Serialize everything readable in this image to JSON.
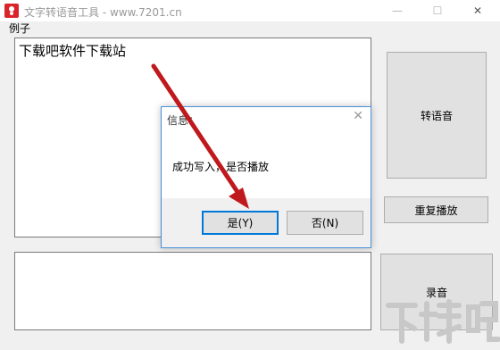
{
  "window": {
    "title": "文字转语音工具 - www.7201.cn",
    "minimize_glyph": "—",
    "maximize_glyph": "☐",
    "close_glyph": "✕"
  },
  "menu": {
    "items": [
      {
        "label": "例子"
      }
    ]
  },
  "main": {
    "input_text": "下载吧软件下载站",
    "output_text": "",
    "convert_button": "转语音",
    "replay_button": "重复播放",
    "record_button": "录音"
  },
  "dialog": {
    "title": "信息：",
    "close_glyph": "✕",
    "message": "成功写入，是否播放",
    "yes_button": "是(Y)",
    "no_button": "否(N)"
  },
  "watermark": {
    "text": "下载吧"
  },
  "colors": {
    "arrow": "#c0191d",
    "accent": "#0078d7",
    "app_icon": "#d9242a"
  }
}
